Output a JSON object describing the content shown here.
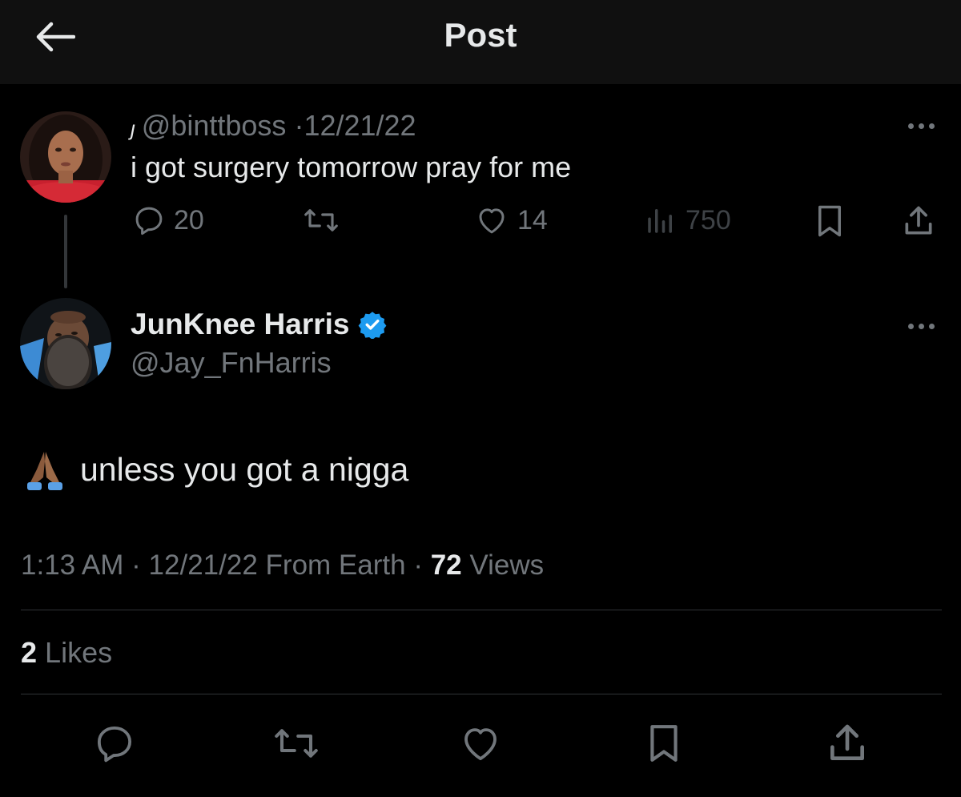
{
  "header": {
    "title": "Post",
    "back_icon": "arrow-left-icon"
  },
  "parent_post": {
    "display_name": "ȷ",
    "handle": "@binttboss",
    "separator": "·",
    "date": "12/21/22",
    "text": "i got surgery tomorrow pray for me",
    "actions": {
      "reply_count": "20",
      "like_count": "14",
      "view_count": "750"
    }
  },
  "post": {
    "display_name": "JunKnee Harris",
    "verified": true,
    "handle": "@Jay_FnHarris",
    "emoji": "folded-hands",
    "text": "unless you got a nigga",
    "time": "1:13 AM",
    "separator": "·",
    "date": "12/21/22",
    "source": "From Earth",
    "views_count": "72",
    "views_label": "Views",
    "likes_count": "2",
    "likes_label": "Likes"
  },
  "colors": {
    "background": "#000000",
    "header_bg": "#101010",
    "text_primary": "#e7e9ea",
    "text_secondary": "#71767b",
    "divider": "#2f3336",
    "verified_blue": "#1d9bf0"
  }
}
